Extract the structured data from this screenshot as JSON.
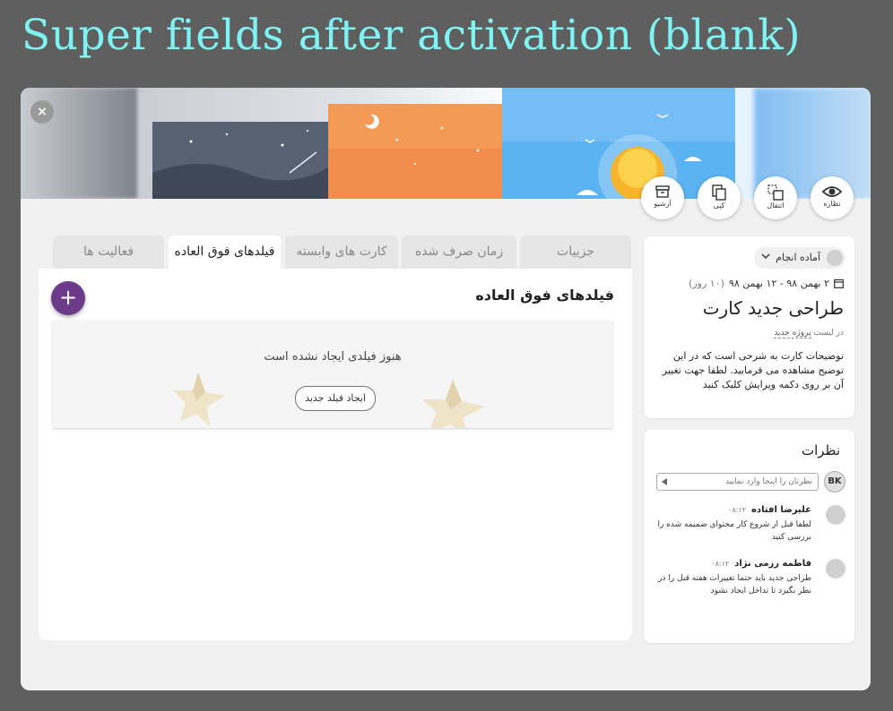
{
  "caption": "Super fields after activation (blank)",
  "modal": {
    "close_label": "×",
    "actions": [
      {
        "label": "نظاره",
        "icon": "eye-icon"
      },
      {
        "label": "انتقال",
        "icon": "move-icon"
      },
      {
        "label": "کپی",
        "icon": "copy-icon"
      },
      {
        "label": "آرشیو",
        "icon": "archive-icon"
      }
    ]
  },
  "card": {
    "status": "آماده انجام",
    "date_range": "۲ بهمن ۹۸ - ۱۲ بهمن ۹۸",
    "duration": "(۱۰ روز)",
    "title": "طراحی جدید کارت",
    "list_prefix": "در لیست",
    "list_name": "پروژه جدید",
    "description": "توضیحات کارت به شرحی است که در این توضیح مشاهده می فرمایید. لطفا جهت تغییر آن بر روی دکمه ویرایش کلیک کنید"
  },
  "comments": {
    "title": "نظرات",
    "current_user_initials": "BK",
    "input_placeholder": "نظرتان را اینجا وارد نمایید",
    "items": [
      {
        "author": "علیرضا افتاده",
        "time": "۰۸:۱۲",
        "text": "لطفا قبل از شروع کار محتوای ضمیمه شده را بررسی کنید"
      },
      {
        "author": "فاطمه رزمی نژاد",
        "time": "۰۸:۱۲",
        "text": "طراحی جدید باید حتما تغییرات هفته قبل را در نظر بگیرد تا تداخل ایجاد نشود"
      }
    ]
  },
  "tabs": [
    "جزییات",
    "زمان صرف شده",
    "کارت های وابسته",
    "فیلدهای فوق العاده",
    "فعالیت ها"
  ],
  "active_tab": "فیلدهای فوق العاده",
  "super_fields": {
    "title": "فیلدهای فوق العاده",
    "add_label": "+",
    "empty_message": "هنوز فیلدی ایجاد نشده است",
    "create_button": "ایجاد فیلد جدید"
  },
  "colors": {
    "caption": "#7ff3f3",
    "fab": "#6b3a8a",
    "background": "#5f5f5f"
  }
}
